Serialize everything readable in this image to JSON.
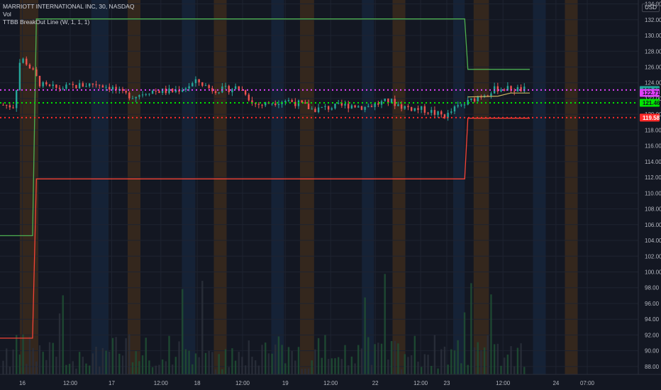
{
  "legend": {
    "symbol": "MARRIOTT INTERNATIONAL INC, 30, NASDAQ",
    "volume": "Vol",
    "indicator": "TTBB BreakOut Line (W, 1, 1, 1)"
  },
  "currency": "USD",
  "colors": {
    "background": "#131722",
    "grid": "#1e2330",
    "up": "#26a69a",
    "down": "#ef5350",
    "upper_line": "#4caf50",
    "lower_line": "#f44336",
    "mid_line": "#c8b560",
    "magenta": "#e040fb",
    "green_dots": "#00e600",
    "red_dots": "#ff2a2a",
    "session_orange": "#3b2a1c",
    "session_blue": "#16243a"
  },
  "chart_data": {
    "type": "candlestick",
    "y_range": [
      87,
      134.5
    ],
    "x_range": [
      0,
      100
    ],
    "y_ticks": [
      88,
      90,
      92,
      94,
      96,
      98,
      100,
      102,
      104,
      106,
      108,
      110,
      112,
      114,
      116,
      118,
      120,
      122,
      124,
      126,
      128,
      130,
      132,
      134
    ],
    "x_ticks": [
      {
        "label": "16",
        "x": 3.5
      },
      {
        "label": "12:00",
        "x": 11.0
      },
      {
        "label": "17",
        "x": 17.5
      },
      {
        "label": "12:00",
        "x": 25.2
      },
      {
        "label": "18",
        "x": 30.9
      },
      {
        "label": "12:00",
        "x": 38.0
      },
      {
        "label": "19",
        "x": 44.7
      },
      {
        "label": "12:00",
        "x": 51.8
      },
      {
        "label": "22",
        "x": 58.8
      },
      {
        "label": "12:00",
        "x": 65.9
      },
      {
        "label": "23",
        "x": 70.0
      },
      {
        "label": "12:00",
        "x": 78.8
      },
      {
        "label": "24",
        "x": 87.1
      },
      {
        "label": "07:00",
        "x": 92.0
      }
    ],
    "price_levels": [
      {
        "value": 123.09,
        "label": "123.09",
        "style": "magenta"
      },
      {
        "value": 122.71,
        "label": "122.71",
        "style": "magenta_badge"
      },
      {
        "value": 121.46,
        "label": "121.46",
        "style": "green"
      },
      {
        "value": 119.58,
        "label": "119.58",
        "style": "red"
      }
    ],
    "breakout_upper": [
      [
        0,
        104.6
      ],
      [
        5.1,
        104.6
      ],
      [
        5.7,
        132.1
      ],
      [
        72.8,
        132.1
      ],
      [
        73.3,
        125.7
      ],
      [
        83.0,
        125.7
      ]
    ],
    "breakout_lower": [
      [
        0,
        91.6
      ],
      [
        5.1,
        91.6
      ],
      [
        5.7,
        111.8
      ],
      [
        72.8,
        111.8
      ],
      [
        73.3,
        119.5
      ],
      [
        83.0,
        119.5
      ]
    ],
    "mid_line": [
      [
        73.3,
        122.2
      ],
      [
        78.0,
        122.3
      ],
      [
        80.0,
        122.7
      ],
      [
        83.0,
        122.7
      ]
    ],
    "volume_max_fraction": 0.27
  }
}
